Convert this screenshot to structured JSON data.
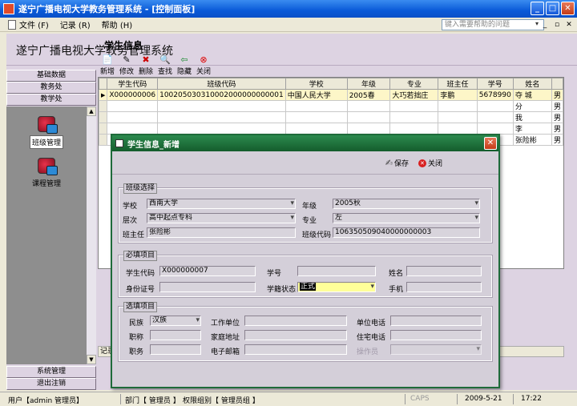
{
  "window": {
    "title": "遂宁广播电视大学教务管理系统 - [控制面板]"
  },
  "menu": {
    "items": [
      "文件 (F)",
      "记录 (R)",
      "帮助 (H)"
    ],
    "help_placeholder": "键入需要帮助的问题"
  },
  "app": {
    "system_title": "遂宁广播电视大学教务管理系统"
  },
  "nav": {
    "top": [
      "基础数据",
      "教务处",
      "教学处"
    ],
    "items": [
      {
        "label": "班级管理",
        "active": true
      },
      {
        "label": "课程管理",
        "active": false
      }
    ],
    "bottom": [
      "系统管理",
      "退出注销"
    ]
  },
  "content": {
    "title": "学生信息",
    "toolbar": [
      {
        "label": "新增",
        "icon": "new-icon"
      },
      {
        "label": "修改",
        "icon": "edit-icon"
      },
      {
        "label": "删除",
        "icon": "delete-icon"
      },
      {
        "label": "查找",
        "icon": "find-icon"
      },
      {
        "label": "隐藏",
        "icon": "hide-icon"
      },
      {
        "label": "关闭",
        "icon": "close-icon"
      }
    ],
    "grid": {
      "columns": [
        "学生代码",
        "班级代码",
        "学校",
        "年级",
        "专业",
        "班主任",
        "学号",
        "姓名",
        ""
      ],
      "rows": [
        [
          "X000000006",
          "100205030310002000000000001",
          "中国人民大学",
          "2005春",
          "大巧若拙庄",
          "李鹏",
          "5678990",
          "夺  城",
          "男"
        ],
        [
          "",
          "",
          "",
          "",
          "",
          "",
          "",
          "分",
          "男"
        ],
        [
          "",
          "",
          "",
          "",
          "",
          "",
          "",
          "我",
          "男"
        ],
        [
          "",
          "",
          "",
          "",
          "",
          "",
          "",
          "李",
          "男"
        ],
        [
          "",
          "",
          "",
          "",
          "",
          "",
          "",
          "张险彬",
          "男"
        ]
      ]
    },
    "footer_label": "记录"
  },
  "status": {
    "user": "用户【admin 管理员】",
    "dept": "部门【 管理员 】",
    "perm": "权限组别【 管理员组 】",
    "caps": "CAPS",
    "date": "2009-5-21",
    "time": "17:22"
  },
  "dialog": {
    "title": "学生信息_新增",
    "save_label": "保存",
    "close_label": "关闭",
    "class_group": {
      "label": "班级选择",
      "school_label": "学校",
      "school_value": "西南大学",
      "grade_label": "年级",
      "grade_value": "2005秋",
      "level_label": "层次",
      "level_value": "高中起点专科",
      "major_label": "专业",
      "major_value": "左",
      "teacher_label": "班主任",
      "teacher_value": "张险彬",
      "class_code_label": "班级代码",
      "class_code_value": "106350509040000000003"
    },
    "required_group": {
      "label": "必填项目",
      "student_code_label": "学生代码",
      "student_code_value": "X000000007",
      "student_no_label": "学号",
      "student_no_value": "",
      "name_label": "姓名",
      "name_value": "",
      "id_label": "身份证号",
      "id_value": "",
      "status_label": "学籍状态",
      "status_value": "正式",
      "phone_label": "手机",
      "phone_value": ""
    },
    "optional_group": {
      "label": "选填项目",
      "ethnic_label": "民族",
      "ethnic_value": "汉族",
      "work_label": "工作单位",
      "work_phone_label": "单位电话",
      "title_label": "职称",
      "home_label": "家庭地址",
      "home_phone_label": "住宅电话",
      "job_label": "职务",
      "email_label": "电子邮箱",
      "operator_label": "操作员"
    }
  }
}
